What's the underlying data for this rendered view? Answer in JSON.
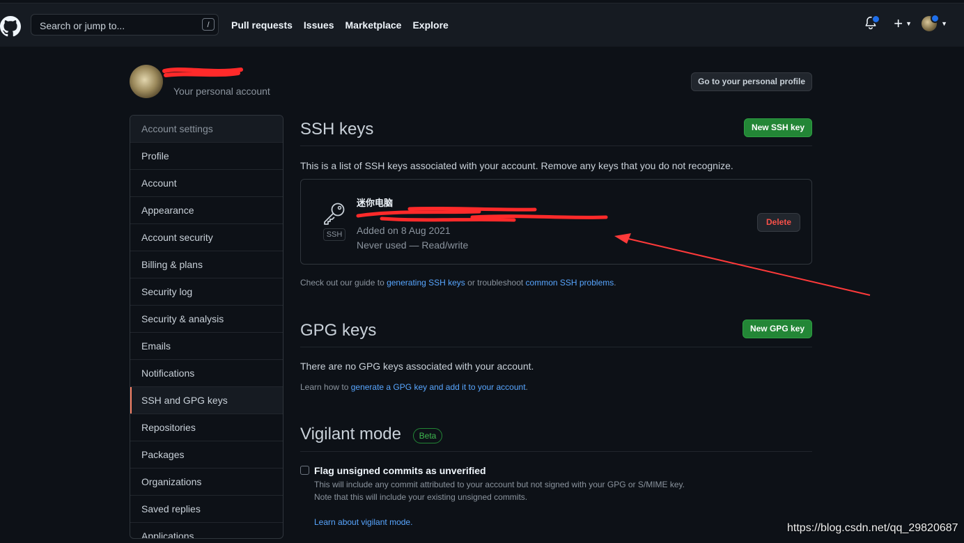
{
  "nav": {
    "search_placeholder": "Search or jump to...",
    "search_shortcut": "/",
    "links": [
      "Pull requests",
      "Issues",
      "Marketplace",
      "Explore"
    ],
    "plus": "+"
  },
  "account": {
    "subtitle": "Your personal account",
    "profile_button": "Go to your personal profile"
  },
  "sidebar": {
    "items": [
      {
        "label": "Account settings",
        "type": "header"
      },
      {
        "label": "Profile"
      },
      {
        "label": "Account"
      },
      {
        "label": "Appearance"
      },
      {
        "label": "Account security"
      },
      {
        "label": "Billing & plans"
      },
      {
        "label": "Security log"
      },
      {
        "label": "Security & analysis"
      },
      {
        "label": "Emails"
      },
      {
        "label": "Notifications"
      },
      {
        "label": "SSH and GPG keys",
        "selected": true
      },
      {
        "label": "Repositories"
      },
      {
        "label": "Packages"
      },
      {
        "label": "Organizations"
      },
      {
        "label": "Saved replies"
      },
      {
        "label": "Applications"
      }
    ]
  },
  "ssh": {
    "title": "SSH keys",
    "new_button": "New SSH key",
    "description": "This is a list of SSH keys associated with your account. Remove any keys that you do not recognize.",
    "key": {
      "name": "迷你电脑",
      "badge": "SSH",
      "added": "Added on 8 Aug 2021",
      "usage": "Never used — Read/write",
      "delete_button": "Delete"
    },
    "guide": {
      "prefix": "Check out our guide to ",
      "link1": "generating SSH keys",
      "middle": " or troubleshoot ",
      "link2": "common SSH problems",
      "suffix": "."
    }
  },
  "gpg": {
    "title": "GPG keys",
    "new_button": "New GPG key",
    "empty": "There are no GPG keys associated with your account.",
    "learn_prefix": "Learn how to ",
    "learn_link": "generate a GPG key and add it to your account",
    "learn_suffix": "."
  },
  "vigilant": {
    "title": "Vigilant mode",
    "badge": "Beta",
    "checkbox_label": "Flag unsigned commits as unverified",
    "note1": "This will include any commit attributed to your account but not signed with your GPG or S/MIME key.",
    "note2": "Note that this will include your existing unsigned commits.",
    "learn_link": "Learn about vigilant mode."
  },
  "watermark": "https://blog.csdn.net/qq_29820687",
  "colors": {
    "background": "#0d1117",
    "header": "#161b22",
    "green": "#238636",
    "danger": "#f85149",
    "link": "#58a6ff",
    "selected_bar": "#f78166",
    "annotation": "#ff3a3a"
  }
}
